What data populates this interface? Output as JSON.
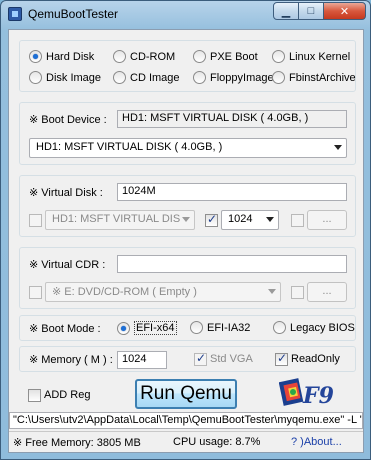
{
  "window": {
    "title": "QemuBootTester"
  },
  "boot_sources": [
    {
      "label": "Hard Disk",
      "selected": true
    },
    {
      "label": "CD-ROM",
      "selected": false
    },
    {
      "label": "PXE Boot",
      "selected": false
    },
    {
      "label": "Linux Kernel",
      "selected": false
    },
    {
      "label": "Disk Image",
      "selected": false
    },
    {
      "label": "CD Image",
      "selected": false
    },
    {
      "label": "FloppyImage",
      "selected": false
    },
    {
      "label": "FbinstArchive",
      "selected": false
    }
  ],
  "boot_device": {
    "label": "※ Boot Device :",
    "value": "HD1: MSFT VIRTUAL DISK ( 4.0GB, )",
    "selected_option": "HD1: MSFT VIRTUAL DISK ( 4.0GB,  )"
  },
  "virtual_disk": {
    "label": "※ Virtual Disk :",
    "value": "1024M",
    "device_option": "HD1: MSFT VIRTUAL DIS",
    "size_option": "1024",
    "browse_label": "..."
  },
  "virtual_cdr": {
    "label": "※ Virtual CDR :",
    "value": "",
    "device_option": "※ E: DVD/CD-ROM  ( Empty  )",
    "browse_label": "..."
  },
  "boot_mode": {
    "label": "※ Boot Mode :",
    "options": [
      {
        "label": "EFI-x64",
        "selected": true
      },
      {
        "label": "EFI-IA32",
        "selected": false
      },
      {
        "label": "Legacy BIOS",
        "selected": false
      }
    ]
  },
  "memory": {
    "label": "※ Memory ( M ) :",
    "value": "1024",
    "std_vga_label": "Std VGA",
    "std_vga_checked": true,
    "readonly_label": "ReadOnly",
    "readonly_checked": true
  },
  "add_reg_label": "ADD Reg",
  "run_button_label": "Run Qemu",
  "logo_text": "F9",
  "command_line": "\"C:\\Users\\utv2\\AppData\\Local\\Temp\\QemuBootTester\\myqemu.exe\" -L \".\\",
  "status": {
    "free_memory": "※ Free Memory:  3805 MB",
    "cpu_usage": "CPU usage:  8.7%",
    "about": "? )About..."
  }
}
